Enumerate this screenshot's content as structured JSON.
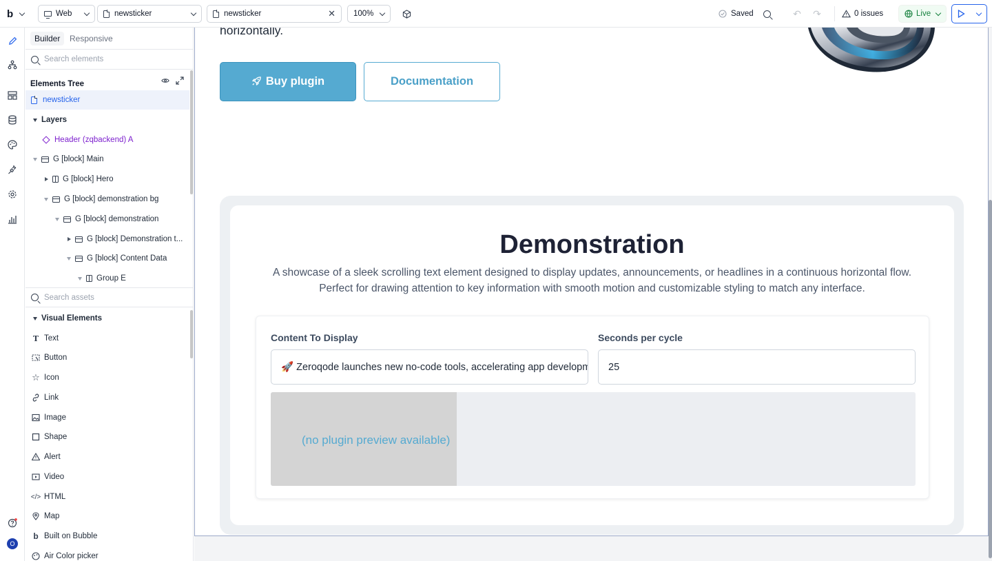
{
  "toolbar": {
    "logo": "b",
    "platform": "Web",
    "page_select": "newsticker",
    "open_tab": "newsticker",
    "zoom": "100%",
    "saved": "Saved",
    "issues": "0 issues",
    "live": "Live"
  },
  "panel": {
    "tabs": [
      "Builder",
      "Responsive"
    ],
    "search_elements_placeholder": "Search elements",
    "tree_title": "Elements Tree",
    "tree": [
      {
        "label": "newsticker"
      },
      {
        "label": "Layers"
      },
      {
        "label": "Header (zqbackend) A"
      },
      {
        "label": "G [block] Main"
      },
      {
        "label": "G [block] Hero"
      },
      {
        "label": "G [block] demonstration bg"
      },
      {
        "label": "G [block] demonstration"
      },
      {
        "label": "G [block] Demonstration t..."
      },
      {
        "label": "G [block] Content Data"
      },
      {
        "label": "Group E"
      }
    ],
    "search_assets_placeholder": "Search assets",
    "visual_elements_title": "Visual Elements",
    "visual_elements": [
      "Text",
      "Button",
      "Icon",
      "Link",
      "Image",
      "Shape",
      "Alert",
      "Video",
      "HTML",
      "Map",
      "Built on Bubble",
      "Air Color picker"
    ]
  },
  "rail": {
    "avatar": "O"
  },
  "canvas": {
    "hero_text_tail": "horizontally.",
    "buy_button": "Buy plugin",
    "doc_button": "Documentation",
    "demo_title": "Demonstration",
    "demo_subtitle_1": "A showcase of a sleek scrolling text element designed to display updates, announcements, or headlines in a continuous horizontal flow.",
    "demo_subtitle_2": "Perfect for drawing attention to key information with smooth motion and customizable styling to match any interface.",
    "content_label": "Content To Display",
    "content_value": "🚀 Zeroqode launches new no-code tools, accelerating app development",
    "seconds_label": "Seconds per cycle",
    "seconds_value": "25",
    "preview_msg": "(no plugin preview available)"
  },
  "colors": {
    "accent": "#55aad1",
    "editor_blue": "#2563eb",
    "live_green": "#15803d",
    "purple": "#7e22ce"
  }
}
